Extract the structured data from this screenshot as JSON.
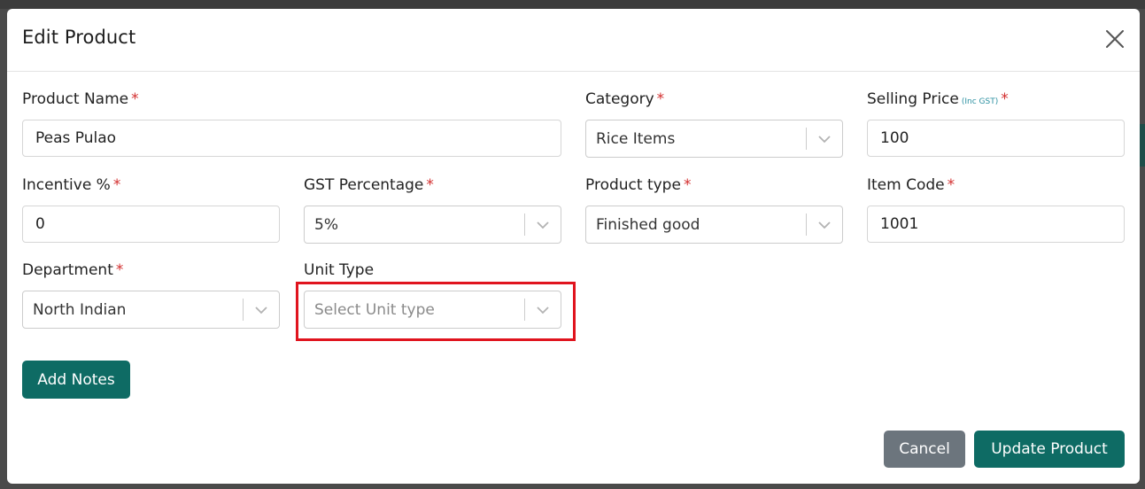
{
  "modal": {
    "title": "Edit Product",
    "close_icon": "close-icon"
  },
  "fields": {
    "product_name": {
      "label": "Product Name",
      "required": "*",
      "value": "Peas Pulao"
    },
    "category": {
      "label": "Category",
      "required": "*",
      "value": "Rice Items"
    },
    "selling_price": {
      "label": "Selling Price",
      "note": "(Inc GST)",
      "required": "*",
      "value": "100"
    },
    "incentive": {
      "label": "Incentive %",
      "required": "*",
      "value": "0"
    },
    "gst_percentage": {
      "label": "GST Percentage",
      "required": "*",
      "value": "5%"
    },
    "product_type": {
      "label": "Product type",
      "required": "*",
      "value": "Finished good"
    },
    "item_code": {
      "label": "Item Code",
      "required": "*",
      "value": "1001"
    },
    "department": {
      "label": "Department",
      "required": "*",
      "value": "North Indian"
    },
    "unit_type": {
      "label": "Unit Type",
      "placeholder": "Select Unit type"
    }
  },
  "buttons": {
    "add_notes": "Add Notes",
    "cancel": "Cancel",
    "update_product": "Update Product"
  },
  "colors": {
    "accent": "#0e6b64",
    "cancel": "#6c757d",
    "required": "#d32f2f",
    "highlight": "#e0141e"
  }
}
